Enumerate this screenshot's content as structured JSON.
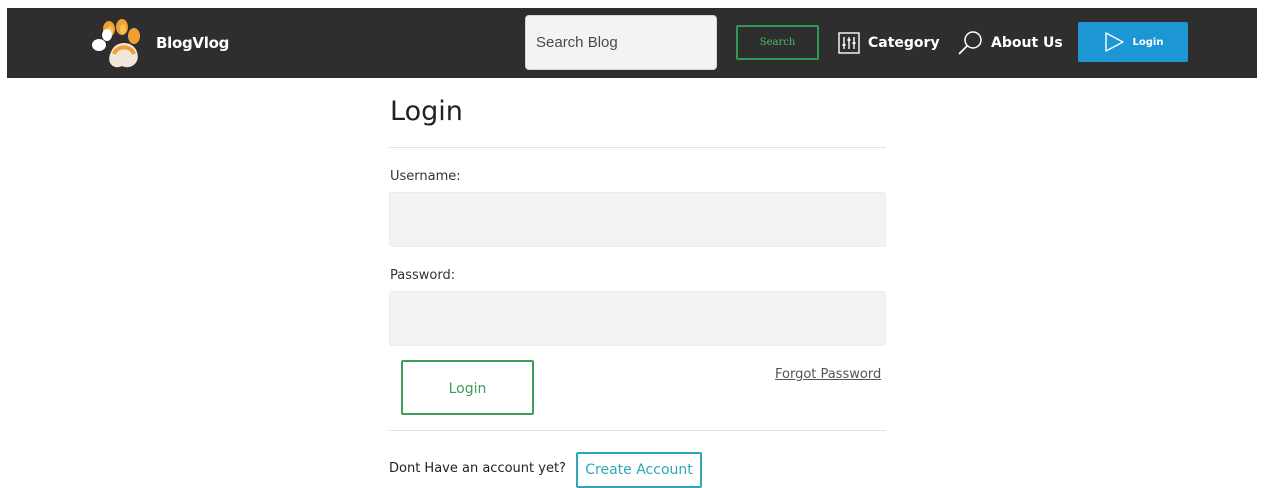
{
  "navbar": {
    "brand": "BlogVlog",
    "logo_icon": "paw-icon",
    "search_placeholder": "Search Blog",
    "search_button": "Search",
    "category_label": "Category",
    "category_icon": "sliders-icon",
    "about_label": "About Us",
    "about_icon": "magnifier-icon",
    "login_label": "Login",
    "login_icon": "play-outline-icon",
    "colors": {
      "bar": "#2e2e2e",
      "login_bg": "#1c97d4",
      "search_border": "#2e9a54"
    }
  },
  "form": {
    "title": "Login",
    "username_label": "Username:",
    "username_value": "",
    "password_label": "Password:",
    "password_value": "",
    "submit_label": "Login",
    "forgot_label": "Forgot Password",
    "no_account_text": "Dont Have an account yet?",
    "create_label": "Create Account",
    "colors": {
      "submit": "#3e9d5a",
      "create": "#2ea7b7"
    }
  }
}
